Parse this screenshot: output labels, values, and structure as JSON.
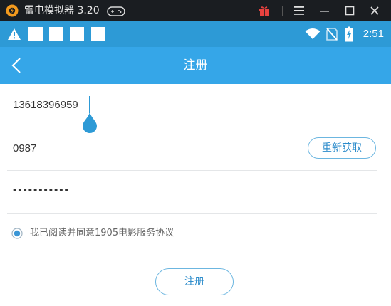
{
  "window": {
    "title": "雷电模拟器 3.20",
    "icons": [
      "leidian-logo-icon",
      "gamepad-icon",
      "gift-icon",
      "menu-icon",
      "minimize-icon",
      "maximize-icon",
      "close-icon"
    ]
  },
  "statusbar": {
    "time": "2:51",
    "icons": [
      "warning-icon",
      "wifi-icon",
      "no-sim-icon",
      "battery-charging-icon"
    ]
  },
  "appbar": {
    "title": "注册",
    "back_icon": "back-arrow-icon"
  },
  "form": {
    "phone": "13618396959",
    "code": "0987",
    "resend_label": "重新获取",
    "password_masked": "•••••••••••",
    "agree_text": "我已阅读并同意1905电影服务协议",
    "agree_checked": true,
    "submit_label": "注册"
  },
  "colors": {
    "titlebar_bg": "#1a1d21",
    "statusbar_bg": "#2d9ad6",
    "appbar_bg": "#35a6e8",
    "accent": "#2d8ccb",
    "gift_red": "#e8423f",
    "logo_orange": "#f39a1e"
  }
}
